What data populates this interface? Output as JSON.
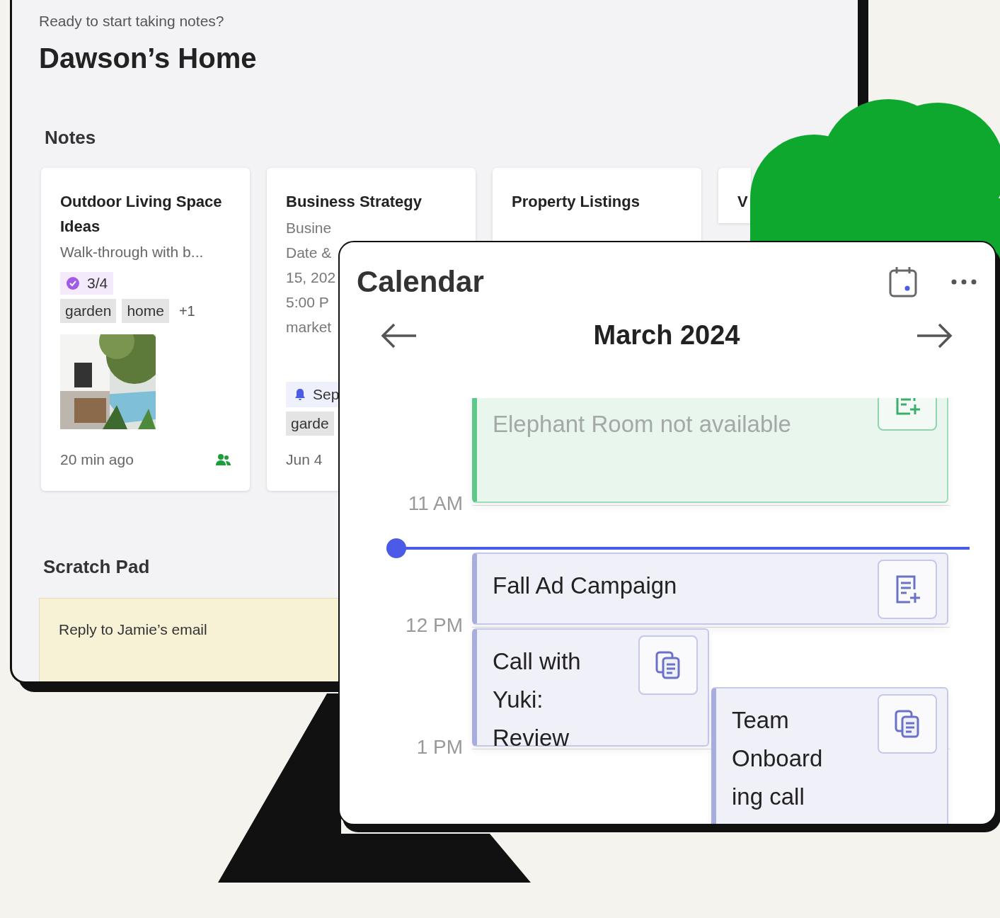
{
  "header": {
    "greeting": "Ready to start taking notes?",
    "title": "Dawson’s Home"
  },
  "notes": {
    "heading": "Notes",
    "cards": [
      {
        "title": "Outdoor Living Space Ideas",
        "snippet": "Walk-through with b...",
        "tasks": "3/4",
        "tags": [
          "garden",
          "home"
        ],
        "more_tags": "+1",
        "image": {
          "kind": "picture"
        },
        "time": "20 min ago",
        "shared": true
      },
      {
        "title": "Business Strategy",
        "lines": [
          "Busine",
          "Date &",
          "15, 202",
          "5:00 P",
          "market"
        ],
        "reminder": "Sep",
        "tags": [
          "garde"
        ],
        "time": "Jun 4"
      },
      {
        "title": "Property Listings"
      },
      {
        "title": "V"
      }
    ]
  },
  "scratch_pad": {
    "heading": "Scratch Pad",
    "note": "Reply to Jamie’s email"
  },
  "calendar": {
    "title": "Calendar",
    "month": "March 2024",
    "hours": [
      "11 AM",
      "12 PM",
      "1 PM"
    ],
    "events": [
      {
        "kind": "unavailable",
        "title": "Elephant Room not available"
      },
      {
        "kind": "task",
        "title": "Fall Ad Campaign"
      },
      {
        "kind": "meeting",
        "title": "Call with Yuki: Review"
      },
      {
        "kind": "meeting",
        "title": "Team Onboarding call"
      }
    ]
  }
}
